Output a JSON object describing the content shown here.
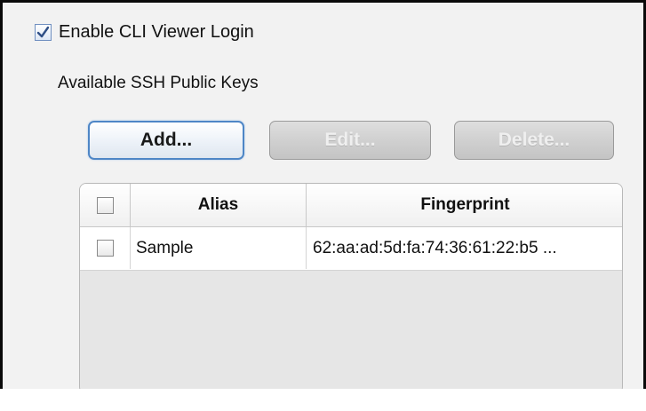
{
  "cli_login": {
    "label": "Enable CLI Viewer Login",
    "checked": true
  },
  "ssh_keys": {
    "section_label": "Available SSH Public Keys",
    "buttons": {
      "add": {
        "label": "Add...",
        "enabled": true
      },
      "edit": {
        "label": "Edit...",
        "enabled": false
      },
      "delete": {
        "label": "Delete...",
        "enabled": false
      }
    },
    "table": {
      "header_checked": false,
      "columns": [
        "Alias",
        "Fingerprint"
      ],
      "rows": [
        {
          "checked": false,
          "alias": "Sample",
          "fingerprint": "62:aa:ad:5d:fa:74:36:61:22:b5 ..."
        }
      ]
    }
  },
  "colors": {
    "accent": "#4e86c6",
    "panel_background": "#f2f2f2",
    "table_background": "#e6e6e6"
  },
  "icons": {
    "check": "check-icon"
  }
}
